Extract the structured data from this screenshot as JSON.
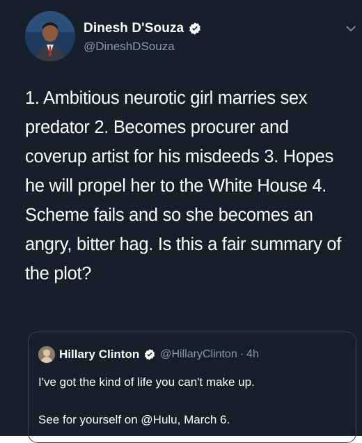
{
  "tweet": {
    "author": {
      "display_name": "Dinesh D'Souza",
      "handle": "@DineshDSouza",
      "verified": true,
      "avatar_icon": "profile-photo"
    },
    "menu_icon": "chevron-down-icon",
    "text": "1. Ambitious neurotic girl marries sex predator 2. Becomes procurer and coverup artist for his misdeeds 3. Hopes he will propel her to the White House 4. Scheme fails and so she becomes an angry, bitter hag. Is this a fair summary of the plot?"
  },
  "quoted_tweet": {
    "author": {
      "display_name": "Hillary Clinton",
      "handle": "@HillaryClinton",
      "verified": true,
      "separator": "·",
      "time": "4h"
    },
    "lines": [
      "I've got the kind of life you can't make up.",
      "See for yourself on @Hulu, March 6."
    ]
  },
  "colors": {
    "background": "#15202b",
    "text": "#ffffff",
    "secondary_text": "#8899a6",
    "verified_badge": "#ffffff",
    "card_border": "#38444d"
  }
}
